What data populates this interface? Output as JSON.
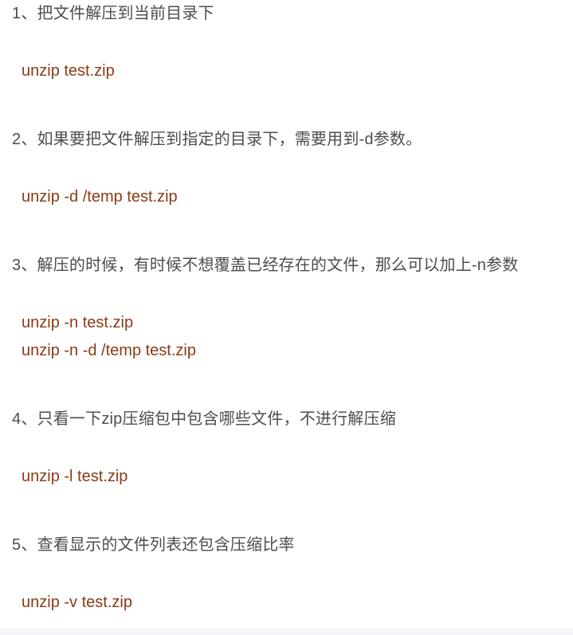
{
  "sections": [
    {
      "heading": "1、把文件解压到当前目录下",
      "code": [
        "unzip test.zip"
      ]
    },
    {
      "heading": "2、如果要把文件解压到指定的目录下，需要用到-d参数。",
      "code": [
        "unzip -d /temp test.zip"
      ]
    },
    {
      "heading": "3、解压的时候，有时候不想覆盖已经存在的文件，那么可以加上-n参数",
      "code": [
        "unzip -n test.zip",
        "unzip -n -d /temp test.zip"
      ]
    },
    {
      "heading": "4、只看一下zip压缩包中包含哪些文件，不进行解压缩",
      "code": [
        "unzip -l test.zip"
      ]
    },
    {
      "heading": "5、查看显示的文件列表还包含压缩比率",
      "code": [
        "unzip -v test.zip"
      ]
    }
  ],
  "colors": {
    "heading_text": "#4d4d4d",
    "code_text": "#8a3b14",
    "background": "#ffffff"
  }
}
